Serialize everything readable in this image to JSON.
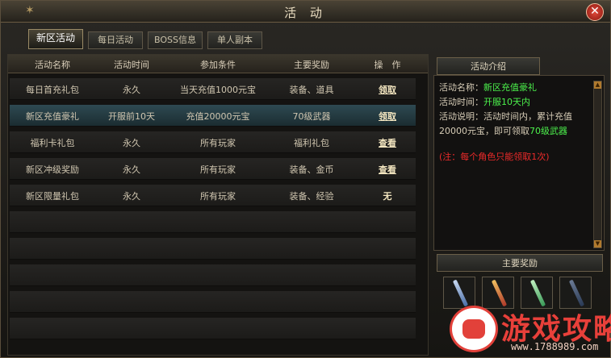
{
  "window": {
    "title": "活 动",
    "corner_icon": "swirl-ornament",
    "close_icon": "close-x"
  },
  "tabs": [
    {
      "label": "新区活动",
      "active": true
    },
    {
      "label": "每日活动",
      "active": false
    },
    {
      "label": "BOSS信息",
      "active": false
    },
    {
      "label": "单人副本",
      "active": false
    }
  ],
  "table": {
    "headers": [
      "活动名称",
      "活动时间",
      "参加条件",
      "主要奖励",
      "操　作"
    ],
    "rows": [
      {
        "name": "每日首充礼包",
        "time": "永久",
        "condition": "当天充值1000元宝",
        "reward": "装备、道具",
        "action": "领取",
        "selected": false
      },
      {
        "name": "新区充值豪礼",
        "time": "开服前10天",
        "condition": "充值20000元宝",
        "reward": "70级武器",
        "action": "领取",
        "selected": true
      },
      {
        "name": "福利卡礼包",
        "time": "永久",
        "condition": "所有玩家",
        "reward": "福利礼包",
        "action": "查看",
        "selected": false
      },
      {
        "name": "新区冲级奖励",
        "time": "永久",
        "condition": "所有玩家",
        "reward": "装备、金币",
        "action": "查看",
        "selected": false
      },
      {
        "name": "新区限量礼包",
        "time": "永久",
        "condition": "所有玩家",
        "reward": "装备、经验",
        "action": "无",
        "selected": false
      }
    ]
  },
  "intro": {
    "header": "活动介绍",
    "name_label": "活动名称：",
    "name_value": "新区充值豪礼",
    "time_label": "活动时间：",
    "time_value": "开服10天内",
    "desc_line1": "活动说明：活动时间内，累计充值",
    "desc_line2a": "20000元宝，即可领取",
    "desc_line2b": "70级武器",
    "note": "(注：每个角色只能领取1次)"
  },
  "rewards": {
    "header": "主要奖励",
    "items": [
      {
        "icon": "sword-blue-icon",
        "color": "#4a6fa8"
      },
      {
        "icon": "staff-red-icon",
        "color": "#b03a2a"
      },
      {
        "icon": "sword-green-icon",
        "color": "#3a9a58"
      },
      {
        "icon": "dark-weapon-icon",
        "color": "#2a3a55"
      }
    ]
  },
  "watermark": {
    "text": "游戏攻略",
    "url": "www.1788989.com"
  },
  "colors": {
    "highlight_green": "#4cf24c",
    "note_red": "#ee2a2a",
    "selected_row": "#2e4a52"
  }
}
